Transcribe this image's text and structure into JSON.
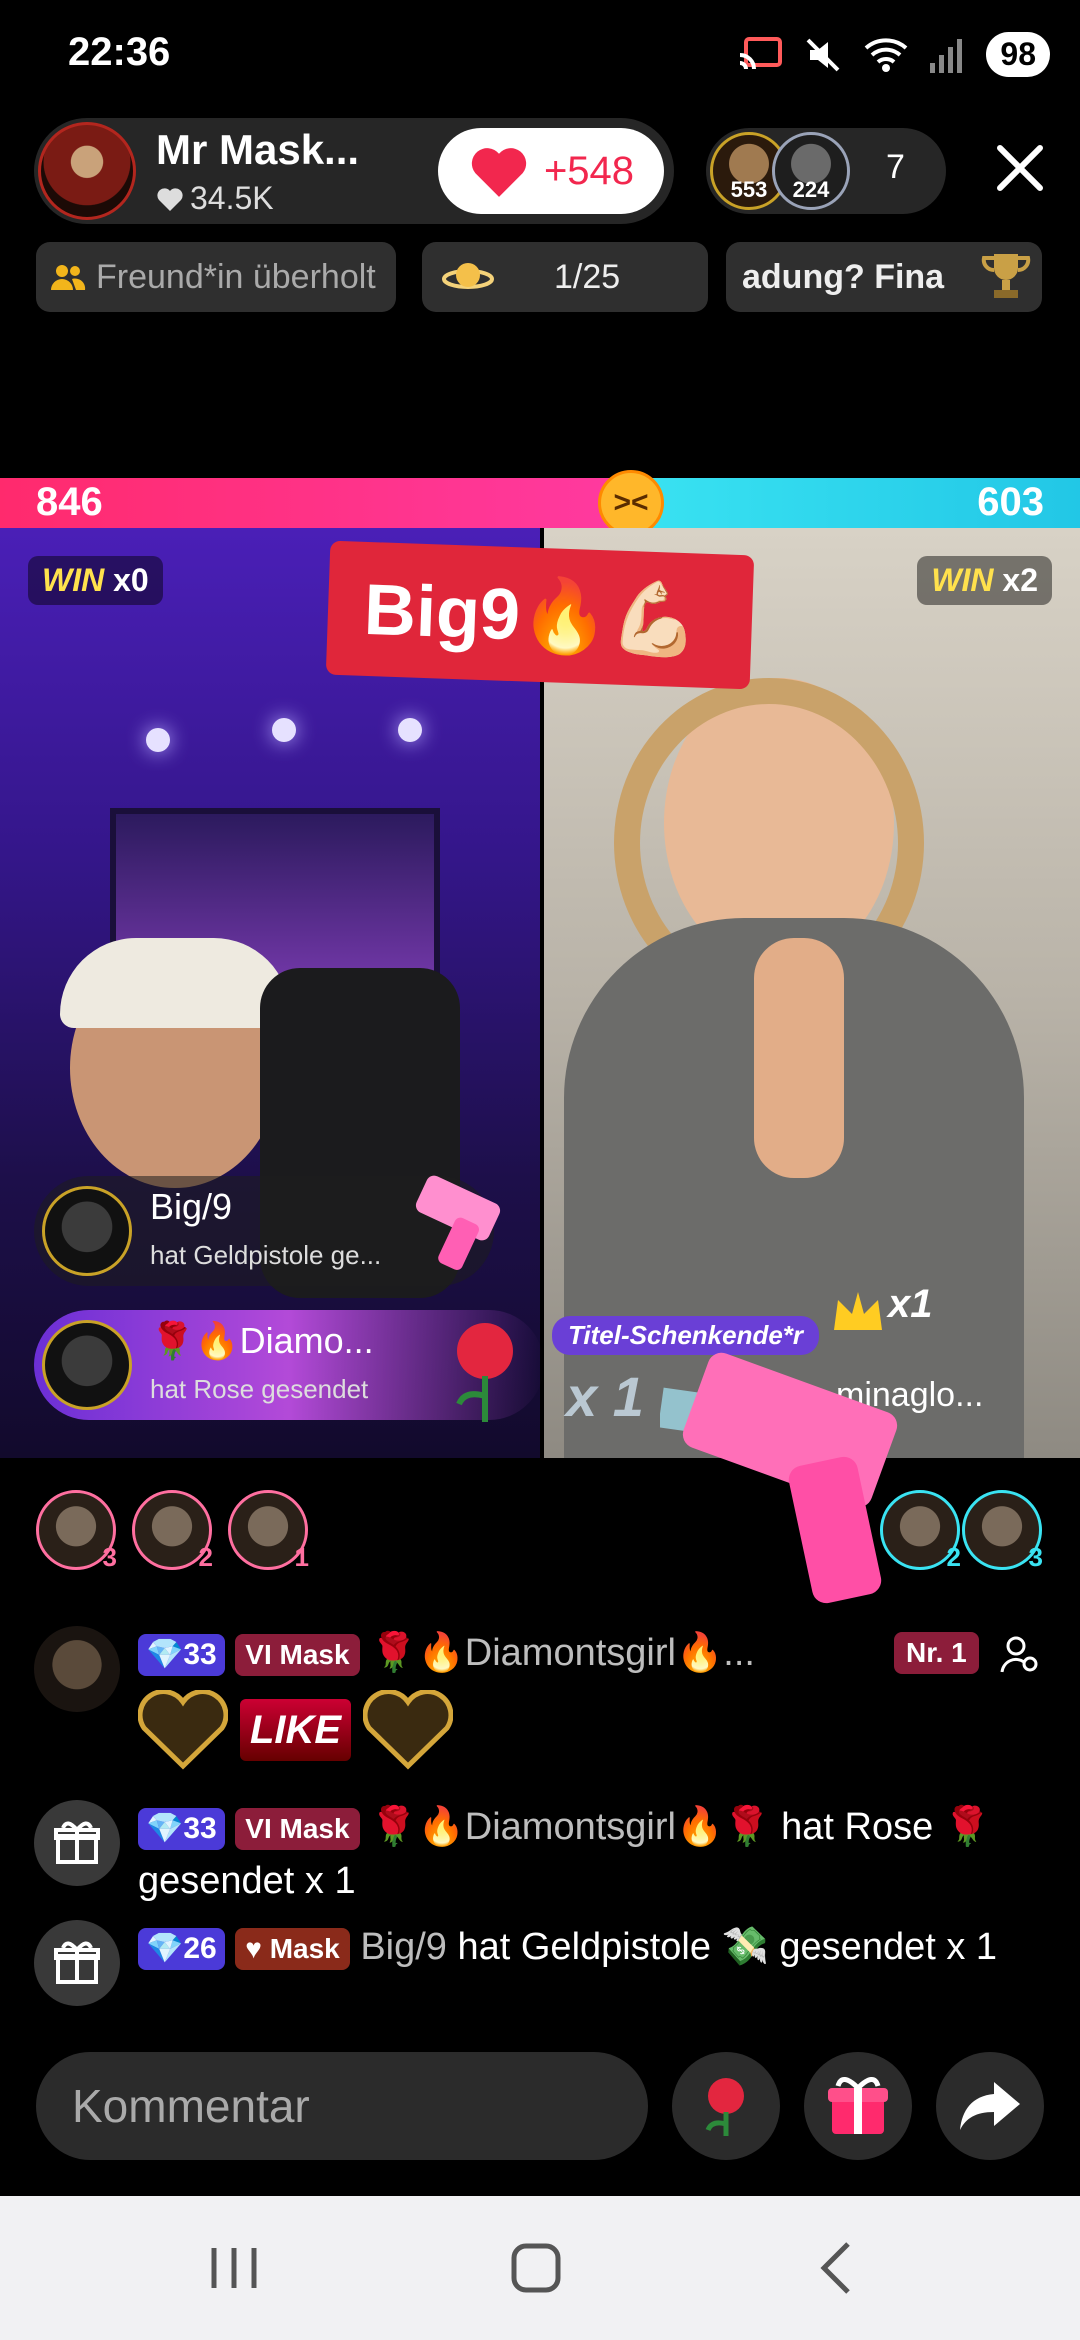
{
  "status": {
    "time": "22:36",
    "battery": "98"
  },
  "host": {
    "name": "Mr Mask...",
    "likes": "34.5K"
  },
  "heart_button": {
    "count": "+548"
  },
  "viewers": {
    "avatars": [
      {
        "badge": "553"
      },
      {
        "badge": "224"
      }
    ],
    "count": "7"
  },
  "chips": {
    "friend": "Freund*in überholt",
    "rank": "1/25",
    "ticker": "adung?   Fina"
  },
  "battle": {
    "left_score": "846",
    "right_score": "603",
    "left_share": 0.58,
    "left_win": "x0",
    "right_win": "x2",
    "win_label": "WIN"
  },
  "banner": {
    "text": "Big9🔥💪🏻"
  },
  "gift_alerts": [
    {
      "name": "Big/9",
      "sub": "hat Geldpistole  ge..."
    },
    {
      "name": "🌹🔥Diamo...",
      "sub": "hat Rose  gesendet"
    }
  ],
  "right_panel": {
    "title_giver": "Titel-Schenkende*r",
    "crown_count": "x1",
    "name": "minaglo...",
    "combo": "x 1"
  },
  "gifters_left": [
    {
      "rank": "3"
    },
    {
      "rank": "2"
    },
    {
      "rank": "1"
    }
  ],
  "gifters_right": [
    {
      "rank": "2"
    },
    {
      "rank": "3"
    }
  ],
  "chat": [
    {
      "level": "33",
      "fan": "Mask",
      "user": "🌹🔥Diamontsgirl🔥...",
      "badge": "Nr. 1",
      "like": "LIKE"
    },
    {
      "level": "33",
      "fan": "Mask",
      "user": "🌹🔥Diamontsgirl🔥🌹",
      "text": " hat Rose 🌹 gesendet x 1"
    },
    {
      "level": "26",
      "fan": "Mask",
      "user": "Big/9",
      "text": " hat Geldpistole 💸 gesendet x 1"
    }
  ],
  "comment": {
    "placeholder": "Kommentar"
  },
  "colors": {
    "accent_pink": "#ff2a6d",
    "accent_cyan": "#22c7e6",
    "level_badge": "#4b3ad8",
    "fan_badge": "#8c1d3a"
  }
}
